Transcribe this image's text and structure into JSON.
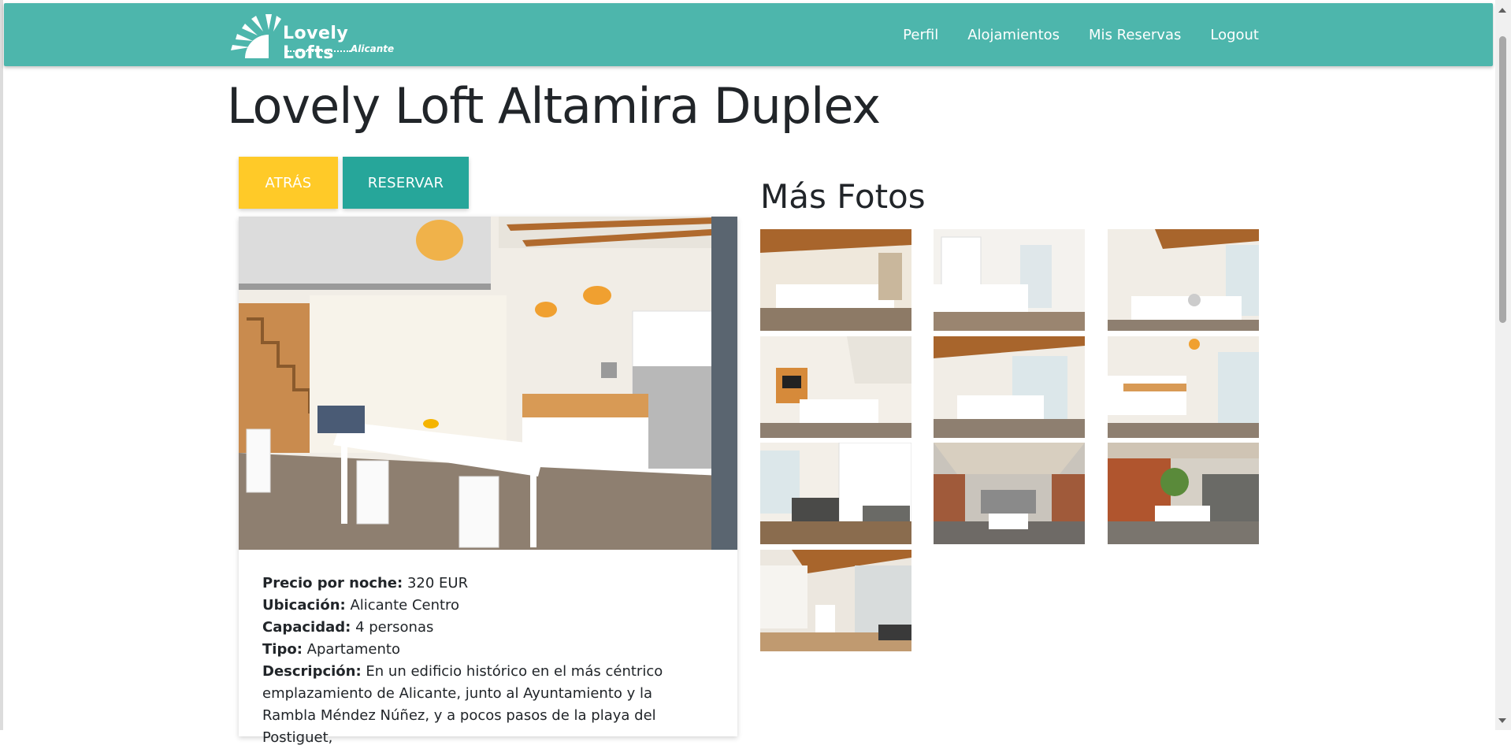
{
  "brand": {
    "name": "Lovely Lofts",
    "city": "Alicante"
  },
  "nav": {
    "items": [
      "Perfil",
      "Alojamientos",
      "Mis Reservas",
      "Logout"
    ]
  },
  "listing": {
    "title": "Lovely Loft Altamira Duplex",
    "buttons": {
      "back": "ATRÁS",
      "book": "RESERVAR"
    },
    "details": [
      {
        "label": "Precio por noche:",
        "value": " 320 EUR"
      },
      {
        "label": "Ubicación:",
        "value": " Alicante Centro"
      },
      {
        "label": "Capacidad:",
        "value": " 4 personas"
      },
      {
        "label": "Tipo:",
        "value": " Apartamento"
      },
      {
        "label": "Descripción:",
        "value": " En un edificio histórico en el más céntrico emplazamiento de Alicante, junto al Ayuntamiento y la Rambla Méndez Núñez, y a pocos pasos de la playa del Postiguet,"
      }
    ]
  },
  "gallery": {
    "title": "Más Fotos",
    "photos": [
      "bedroom-wood-beams",
      "bedroom-white",
      "dining-kitchen",
      "living-tv",
      "dining-windows",
      "kitchen-island",
      "living-sofa",
      "terrace-covered",
      "terrace-plants",
      "bathroom"
    ]
  },
  "colors": {
    "navbar": "#4db6ac",
    "back_button": "#ffca28",
    "book_button": "#26a69a"
  }
}
